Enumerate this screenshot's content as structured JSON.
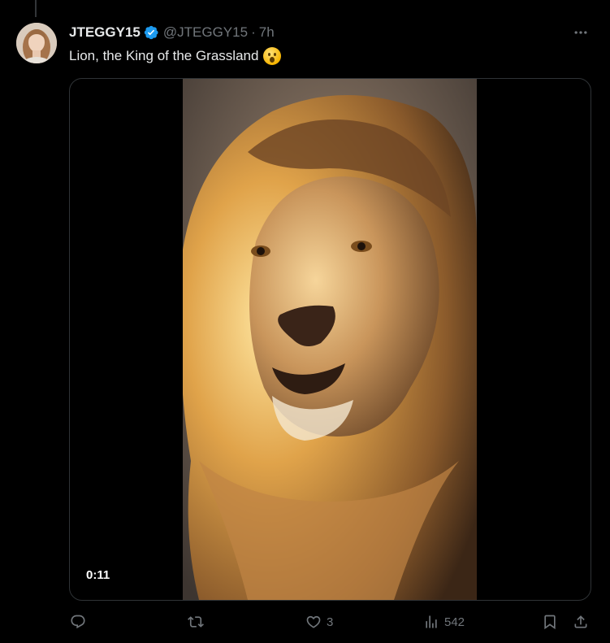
{
  "tweet": {
    "display_name": "JTEGGY15",
    "handle": "@JTEGGY15",
    "separator": "·",
    "time": "7h",
    "text": "Lion, the King of the Grassland",
    "emoji": "astonished-face",
    "verified": true
  },
  "media": {
    "type": "video",
    "duration": "0:11"
  },
  "actions": {
    "reply_count": "",
    "retweet_count": "",
    "like_count": "3",
    "views_count": "542"
  },
  "colors": {
    "background": "#000000",
    "text_primary": "#e7e9ea",
    "text_secondary": "#71767b",
    "verified_blue": "#1d9bf0",
    "border": "#2f3336"
  }
}
